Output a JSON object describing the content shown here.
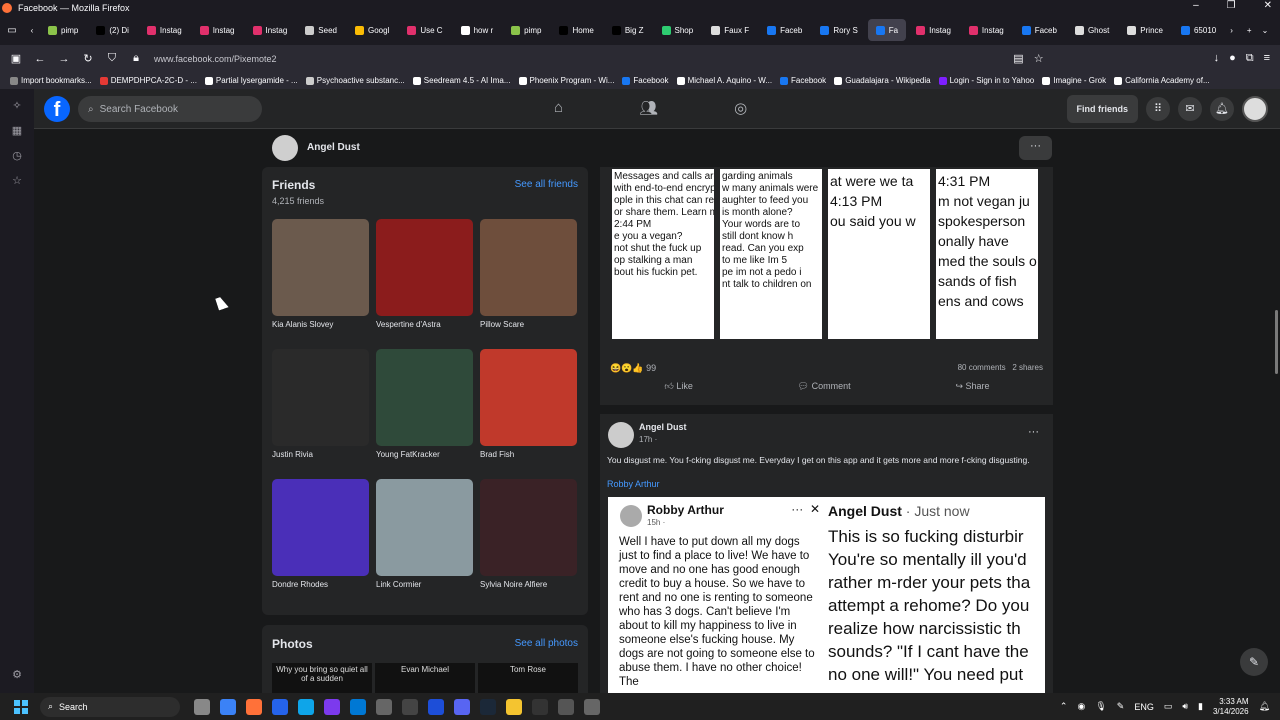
{
  "window": {
    "title": "Facebook — Mozilla Firefox"
  },
  "tabs": [
    {
      "label": "pimp",
      "color": "#8bc34a"
    },
    {
      "label": "(2) Di",
      "color": "#000000"
    },
    {
      "label": "Instag",
      "color": "#e1306c"
    },
    {
      "label": "Instag",
      "color": "#e1306c"
    },
    {
      "label": "Instag",
      "color": "#e1306c"
    },
    {
      "label": "Seed",
      "color": "#cccccc"
    },
    {
      "label": "Googl",
      "color": "#fbbc05"
    },
    {
      "label": "Use C",
      "color": "#e1306c"
    },
    {
      "label": "how r",
      "color": "#ffffff"
    },
    {
      "label": "pimp",
      "color": "#8bc34a"
    },
    {
      "label": "Home",
      "color": "#000000"
    },
    {
      "label": "Big Z",
      "color": "#000000"
    },
    {
      "label": "Shop",
      "color": "#2ecc71"
    },
    {
      "label": "Faux F",
      "color": "#dddddd"
    },
    {
      "label": "Faceb",
      "color": "#1877f2"
    },
    {
      "label": "Rory S",
      "color": "#1877f2"
    },
    {
      "label": "Fa",
      "color": "#1877f2",
      "active": true
    },
    {
      "label": "Instag",
      "color": "#e1306c"
    },
    {
      "label": "Instag",
      "color": "#e1306c"
    },
    {
      "label": "Faceb",
      "color": "#1877f2"
    },
    {
      "label": "Ghost",
      "color": "#dddddd"
    },
    {
      "label": "Prince",
      "color": "#dddddd"
    },
    {
      "label": "65010",
      "color": "#1877f2"
    }
  ],
  "url": "www.facebook.com/Pixemote2",
  "bookmarks": [
    {
      "label": "Import bookmarks...",
      "color": "#888888"
    },
    {
      "label": "DEMPDHPCA-2C-D - ...",
      "color": "#e53935"
    },
    {
      "label": "Partial lysergamide - ...",
      "color": "#ffffff"
    },
    {
      "label": "Psychoactive substanc...",
      "color": "#cccccc"
    },
    {
      "label": "Seedream 4.5 - AI Ima...",
      "color": "#ffffff"
    },
    {
      "label": "Phoenix Program - Wi...",
      "color": "#ffffff"
    },
    {
      "label": "Facebook",
      "color": "#1877f2"
    },
    {
      "label": "Michael A. Aquino - W...",
      "color": "#ffffff"
    },
    {
      "label": "Facebook",
      "color": "#1877f2"
    },
    {
      "label": "Guadalajara - Wikipedia",
      "color": "#ffffff"
    },
    {
      "label": "Login - Sign in to Yahoo",
      "color": "#7e1fff"
    },
    {
      "label": "Imagine - Grok",
      "color": "#ffffff"
    },
    {
      "label": "California Academy of...",
      "color": "#ffffff"
    }
  ],
  "fb": {
    "search_placeholder": "Search Facebook",
    "find_friends": "Find friends",
    "profile_name": "Angel Dust"
  },
  "friends": {
    "title": "Friends",
    "count": "4,215 friends",
    "see_all": "See all friends",
    "items": [
      {
        "name": "Kia Alanis Slovey",
        "color": "#6b5a4d"
      },
      {
        "name": "Vespertine d'Astra",
        "color": "#8b1c1c"
      },
      {
        "name": "Pillow Scare",
        "color": "#6e4e3c"
      },
      {
        "name": "Justin Rivia",
        "color": "#2a2a2a"
      },
      {
        "name": "Young FatKracker",
        "color": "#2f4a3a"
      },
      {
        "name": "Brad Fish",
        "color": "#c0392b"
      },
      {
        "name": "Dondre Rhodes",
        "color": "#4a2fb8"
      },
      {
        "name": "Link Cormier",
        "color": "#8a9aa0"
      },
      {
        "name": "Sylvia Noire Alfiere",
        "color": "#3a2226"
      }
    ]
  },
  "photos": {
    "title": "Photos",
    "see_all": "See all photos",
    "thumbs": [
      "Why you bring so quiet all of a sudden",
      "Evan Michael",
      "Tom Rose"
    ]
  },
  "post1": {
    "collage": [
      {
        "lines": [
          "Messages and calls are se",
          "with end-to-end encryption.",
          "ople in this chat can read,",
          "or share them. Learn mo",
          "2:44 PM",
          "e you a vegan?",
          "not shut the fuck up",
          "op stalking a man",
          "bout his fuckin pet."
        ]
      },
      {
        "lines": [
          "garding animals",
          "w many animals were",
          "aughter to feed you",
          "is month alone?",
          "Your words are to",
          "still dont know h",
          "read. Can you exp",
          "to me like Im 5",
          "pe im not a pedo i",
          "nt talk to children on"
        ]
      },
      {
        "lines": [
          "at were we ta",
          "4:13 PM",
          "ou said you w"
        ]
      },
      {
        "lines": [
          "4:31 PM",
          "m not vegan ju",
          "spokesperson",
          "onally have",
          "med the souls o",
          "sands of fish",
          "ens and cows"
        ]
      }
    ],
    "reaction_count": "99",
    "comments": "80 comments",
    "shares": "2 shares",
    "like": "Like",
    "comment": "Comment",
    "share": "Share"
  },
  "post2": {
    "author": "Angel Dust",
    "time": "17h ·",
    "text": "You disgust me. You f-cking disgust me. Everyday I get on this app and it gets more and more f-cking disgusting.",
    "tag": "Robby Arthur",
    "screenshot": {
      "left_name": "Robby Arthur",
      "left_time": "15h ·",
      "left_body": "Well I have to put down all my dogs just to find a place to live! We have to move and no one has good enough credit to buy a house. So we have to rent and no one is renting to someone who has 3 dogs. Can't believe I'm about to kill my happiness to live in someone else's fucking house. My dogs are not going to someone else to abuse them. I have no other choice! The",
      "right_name": "Angel Dust",
      "right_time": "· Just now",
      "right_lines": [
        "This is so fucking disturbir",
        "You're so mentally ill you'd",
        "rather m-rder your pets tha",
        "attempt a rehome? Do you",
        "realize how narcissistic th",
        "sounds? \"If I cant have the",
        "no one will!\" You need put"
      ]
    }
  },
  "taskbar": {
    "search": "Search",
    "lang": "ENG",
    "time": "3:33 AM",
    "date": "3/14/2026"
  }
}
